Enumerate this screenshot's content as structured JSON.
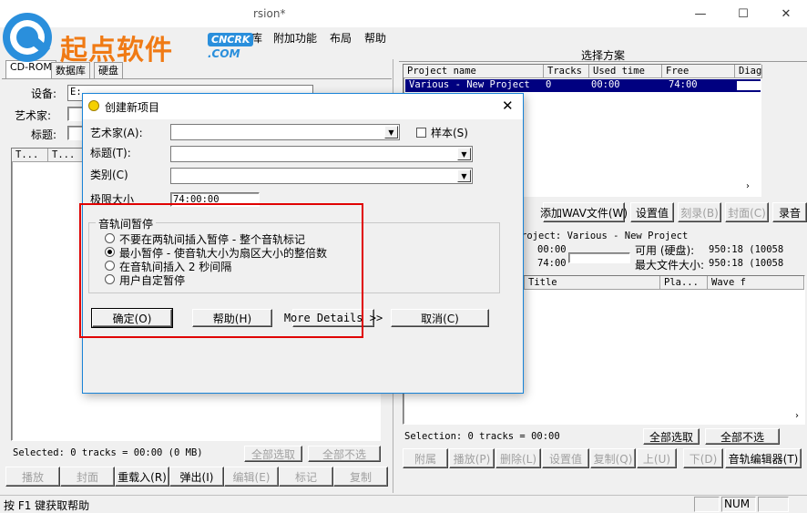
{
  "window": {
    "title_fragment": "rsion*",
    "controls": [
      "—",
      "☐",
      "✕"
    ]
  },
  "logo": {
    "text": "起点软件",
    "badge": "CNCRK",
    "domain": ".COM"
  },
  "menu": [
    "库",
    "附加功能",
    "布局",
    "帮助"
  ],
  "left": {
    "tabs": [
      "CD-ROM",
      "数据库",
      "硬盘"
    ],
    "device_label": "设备:",
    "device_value": "E:",
    "artist_label": "艺术家:",
    "title_label": "标题:",
    "cols": [
      "T...",
      "T..."
    ],
    "selected": "Selected: 0 tracks = 00:00 (0 MB)",
    "select_all": "全部选取",
    "deselect_all": "全部不选",
    "buttons": [
      "播放",
      "封面",
      "重载入(R)",
      "弹出(I)",
      "编辑(E)",
      "标记",
      "复制"
    ]
  },
  "right": {
    "scheme_title": "选择方案",
    "cols": [
      "Project name",
      "Tracks",
      "Used time",
      "Free",
      "Diag"
    ],
    "row": [
      "Various - New Project",
      "0",
      "00:00",
      "74:00"
    ],
    "toolbar": [
      "添加WAV文件(W)",
      "设置值",
      "刻录(B)",
      "封面(C)",
      "录音"
    ],
    "project_line": "roject: Various - New Project",
    "time1": "00:00",
    "time2": "74:00",
    "avail_label": "可用 (硬盘):",
    "avail_value": "950:18 (10058",
    "maxfile_label": "最大文件大小:",
    "maxfile_value": "950:18 (10058",
    "track_cols": [
      "Title",
      "Pla...",
      "Wave f"
    ],
    "selection": "Selection: 0 tracks = 00:00",
    "select_all": "全部选取",
    "deselect_all": "全部不选",
    "bottom_buttons": [
      "附属",
      "播放(P)",
      "删除(L)",
      "设置值",
      "复制(Q)",
      "上(U)",
      "下(D)",
      "音轨编辑器(T)"
    ]
  },
  "status": {
    "hint": "按 F1 键获取帮助",
    "num": "NUM"
  },
  "dialog": {
    "title": "创建新项目",
    "artist_label": "艺术家(A):",
    "sample_label": "样本(S)",
    "title_label": "标题(T):",
    "category_label": "类别(C)",
    "limit_label": "极限大小",
    "limit_value": "74:00:00",
    "group_label": "音轨间暂停",
    "options": [
      "不要在两轨间插入暂停 - 整个音轨标记",
      "最小暂停 - 使音轨大小为扇区大小的整倍数",
      "在音轨间插入 2 秒间隔",
      "用户自定暂停"
    ],
    "selected_option": 1,
    "ok": "确定(O)",
    "help": "帮助(H)",
    "more": "More Details >>",
    "cancel": "取消(C)"
  },
  "colors": {
    "highlight": "#e00000",
    "selection_row": "#000080",
    "accent": "#1883d7",
    "logo_orange": "#f07a14",
    "logo_blue": "#2a8fdc"
  }
}
